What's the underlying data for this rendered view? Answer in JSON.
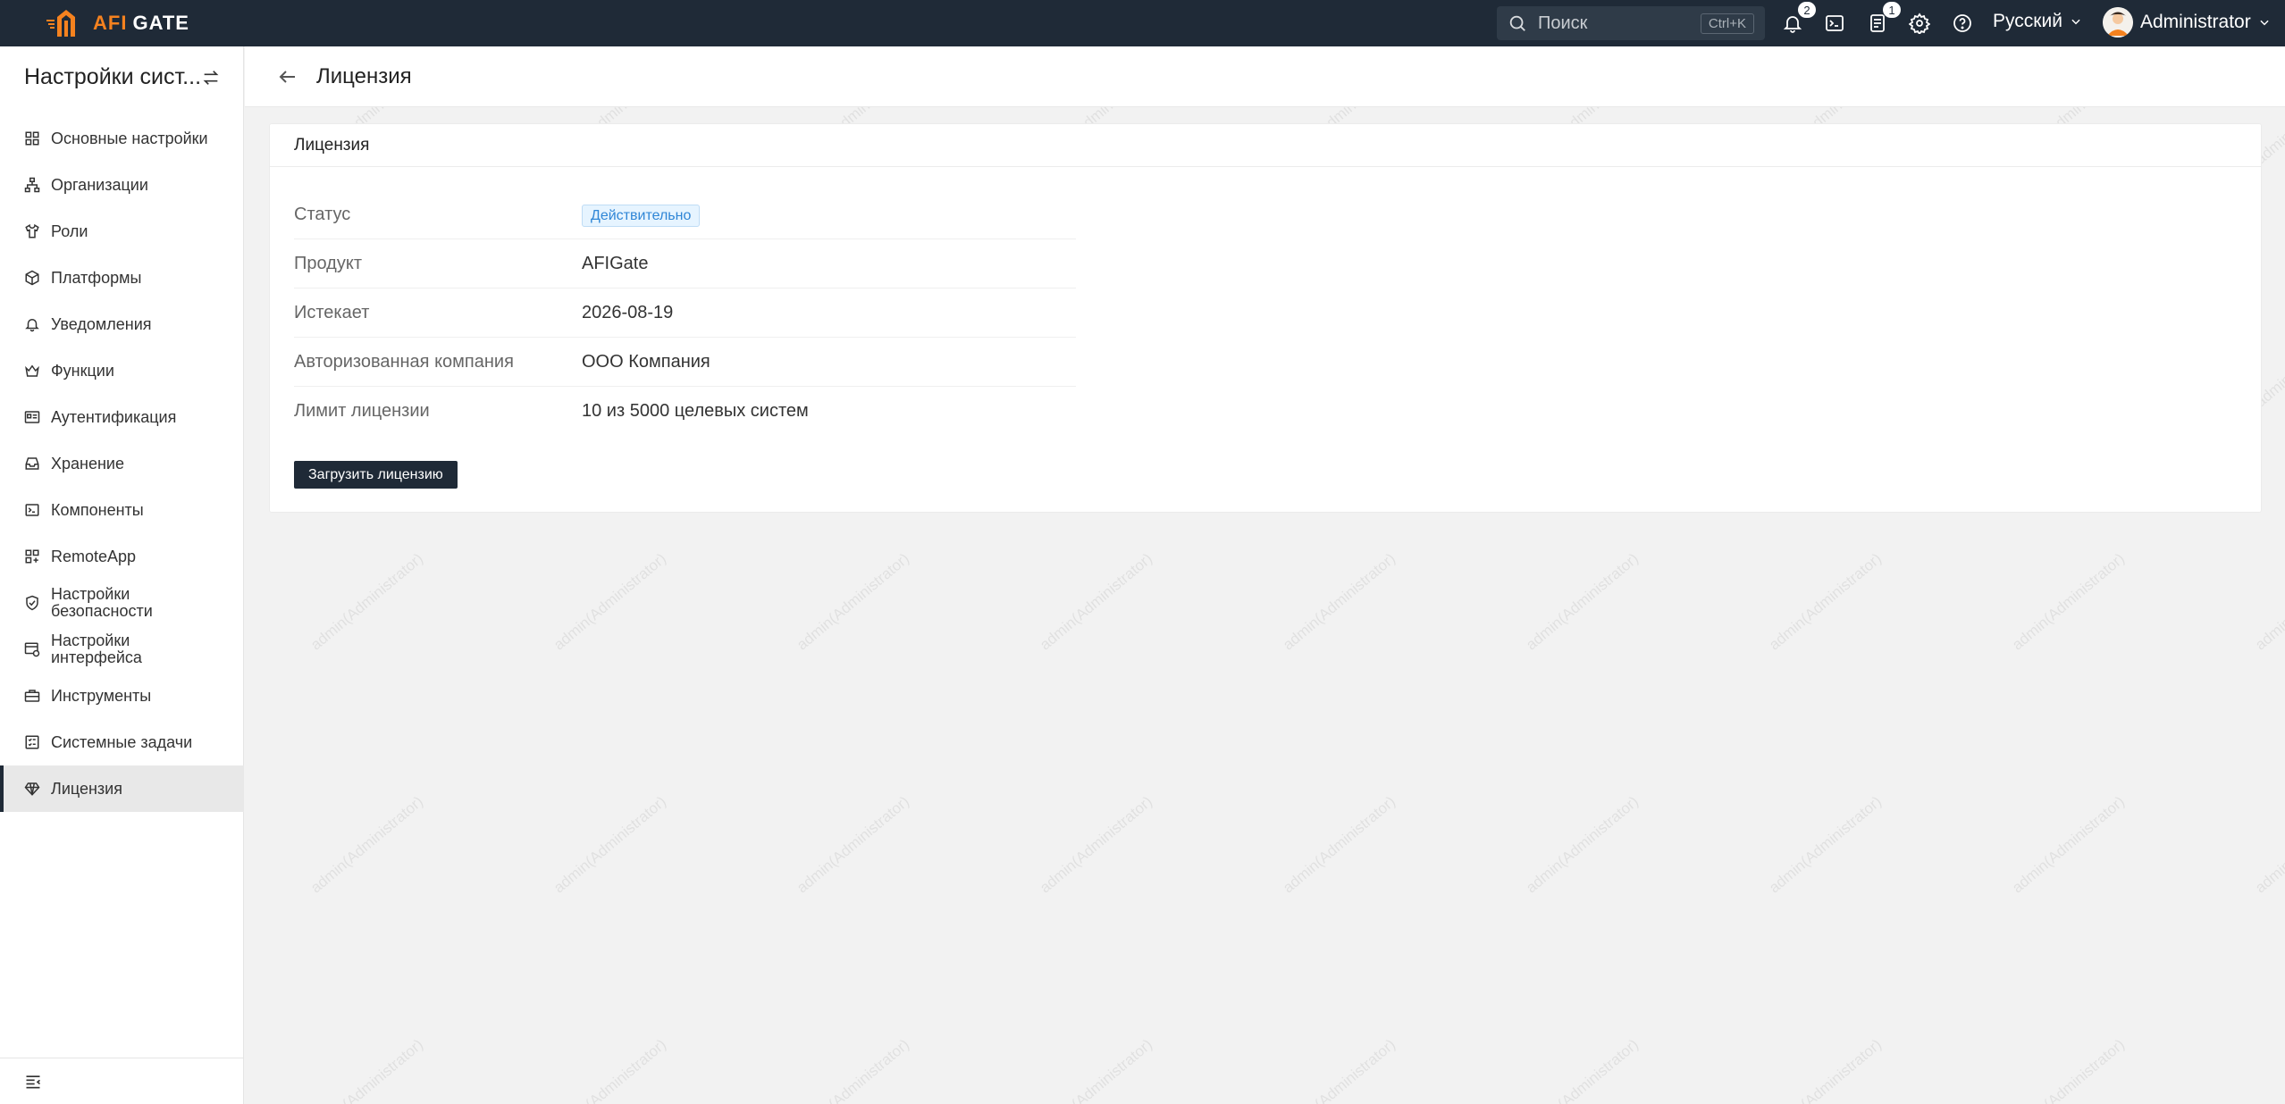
{
  "topbar": {
    "logo_afi": "AFI",
    "logo_gate": "GATE",
    "search_placeholder": "Поиск",
    "search_shortcut": "Ctrl+K",
    "notifications_count": "2",
    "tasks_count": "1",
    "language": "Русский",
    "user_name": "Administrator"
  },
  "sidebar": {
    "title": "Настройки сист...",
    "items": [
      {
        "label": "Основные настройки",
        "icon": "grid-icon"
      },
      {
        "label": "Организации",
        "icon": "org-tree-icon"
      },
      {
        "label": "Роли",
        "icon": "shirt-icon"
      },
      {
        "label": "Платформы",
        "icon": "cube-icon"
      },
      {
        "label": "Уведомления",
        "icon": "bell-icon"
      },
      {
        "label": "Функции",
        "icon": "crown-icon"
      },
      {
        "label": "Аутентификация",
        "icon": "id-card-icon"
      },
      {
        "label": "Хранение",
        "icon": "inbox-icon"
      },
      {
        "label": "Компоненты",
        "icon": "terminal-icon"
      },
      {
        "label": "RemoteApp",
        "icon": "apps-icon"
      },
      {
        "label": "Настройки безопасности",
        "icon": "shield-check-icon"
      },
      {
        "label": "Настройки интерфейса",
        "icon": "interface-icon"
      },
      {
        "label": "Инструменты",
        "icon": "toolbox-icon"
      },
      {
        "label": "Системные задачи",
        "icon": "task-list-icon"
      },
      {
        "label": "Лицензия",
        "icon": "diamond-icon",
        "active": true
      }
    ]
  },
  "page": {
    "title": "Лицензия"
  },
  "card": {
    "title": "Лицензия",
    "rows": [
      {
        "key": "Статус",
        "value": "Действительно"
      },
      {
        "key": "Продукт",
        "value": "AFIGate"
      },
      {
        "key": "Истекает",
        "value": "2026-08-19"
      },
      {
        "key": "Авторизованная компания",
        "value": "ООО Компания"
      },
      {
        "key": "Лимит лицензии",
        "value": "10 из 5000 целевых систем"
      }
    ],
    "upload_button": "Загрузить лицензию"
  },
  "watermark": "admin(Administrator)",
  "colors": {
    "topbar_bg": "#1f2a37",
    "brand_orange": "#f5821f",
    "status_tag": "#2f86d6",
    "page_bg": "#f2f2f2"
  }
}
